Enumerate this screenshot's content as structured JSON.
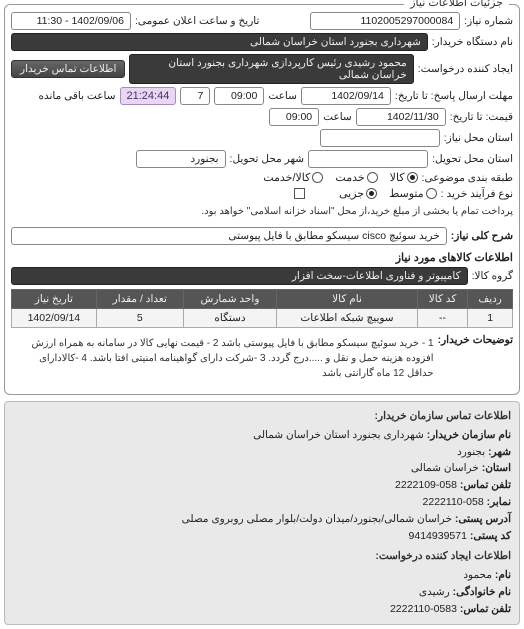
{
  "panel_title": "جزئیات اطلاعات نیاز",
  "fields": {
    "req_no_label": "شماره نیاز:",
    "req_no": "1102005297000084",
    "pub_dt_label": "تاریخ و ساعت اعلان عمومی:",
    "pub_dt": "1402/09/06 - 11:30",
    "buyer_org_label": "نام دستگاه خریدار:",
    "buyer_org": "شهرداری بجنورد استان خراسان شمالی",
    "requester_label": "ایجاد کننده درخواست:",
    "requester": "محمود رشیدی رئیس کارپردازی شهرداری بجنورد استان خراسان شمالی",
    "contact_btn": "اطلاعات تماس خریدار",
    "deadline_label": "مهلت ارسال پاسخ: تا تاریخ:",
    "deadline_date": "1402/09/14",
    "time_label": "ساعت",
    "deadline_time": "09:00",
    "remaining_days": "7",
    "remaining_time": "21:24:44",
    "remaining_caption": "ساعت باقی مانده",
    "until_label": "قیمت: تا تاریخ:",
    "until_date": "1402/11/30",
    "until_time": "09:00",
    "need_state_label": "استان محل نیاز:",
    "need_state": "",
    "deliv_state_label": "استان محل تحویل:",
    "deliv_city_label": "شهر محل تحویل:",
    "deliv_city": "بجنورد",
    "budget_class_label": "طبقه بندی موضوعی:",
    "budget_opts": {
      "goods": "کالا",
      "services": "خدمت",
      "goods_services": "کالا/خدمت"
    },
    "buy_type_label": "نوع فرآیند خرید :",
    "buy_opts": {
      "average": "متوسط",
      "partial": "جزیی"
    },
    "pay_note": "پرداخت تمام یا بخشی از مبلغ خرید،از محل \"اسناد خزانه اسلامی\" خواهد بود.",
    "need_desc_label": "شرح کلی نیاز:",
    "need_desc": "خرید سوئیچ cisco سیسکو مطابق با فایل پیوستی"
  },
  "goods_info_title": "اطلاعات کالاهای مورد نیاز",
  "goods_group_label": "گروه کالا:",
  "goods_group": "کامپیوتر و فناوری اطلاعات-سخت افزار",
  "table": {
    "headers": [
      "ردیف",
      "کد کالا",
      "نام کالا",
      "واحد شمارش",
      "تعداد / مقدار",
      "تاریخ نیاز"
    ],
    "rows": [
      {
        "idx": "1",
        "code": "--",
        "name": "سوییچ شبکه اطلاعات",
        "unit": "دستگاه",
        "qty": "5",
        "date": "1402/09/14"
      }
    ]
  },
  "explain_label": "توضیحات خریدار:",
  "explain_text": "1 - خرید سوئیچ سیسکو مطابق با فایل پیوستی باشد 2 - قیمت نهایی کالا در سامانه به همراه ارزش افزوده هزینه حمل و نقل و .....درج گردد. 3 -شرکت دارای گواهینامه امنیتی افتا باشد. 4 -کالادارای حداقل 12 ماه گارانتی باشد",
  "contact": {
    "title": "اطلاعات تماس سازمان خریدار:",
    "org_name_k": "نام سازمان خریدار:",
    "org_name": "شهرداری بجنورد استان خراسان شمالی",
    "city_k": "شهر:",
    "city": "بجنورد",
    "state_k": "استان:",
    "state": "خراسان شمالی",
    "tel_k": "تلفن تماس:",
    "tel": "058-2222109",
    "fax_k": "نمابر:",
    "fax": "058-2222110",
    "address_k": "آدرس پستی:",
    "address": "خراسان شمالی/بجنورد/میدان دولت/بلوار مصلی روبروی مصلی",
    "postal_k": "کد پستی:",
    "postal": "9414939571",
    "creator_title": "اطلاعات ایجاد کننده درخواست:",
    "name_k": "نام:",
    "name_v": "محمود",
    "family_k": "نام خانوادگی:",
    "family_v": "رشیدی",
    "phone_k": "تلفن تماس:",
    "phone_v": "0583-2222110"
  }
}
